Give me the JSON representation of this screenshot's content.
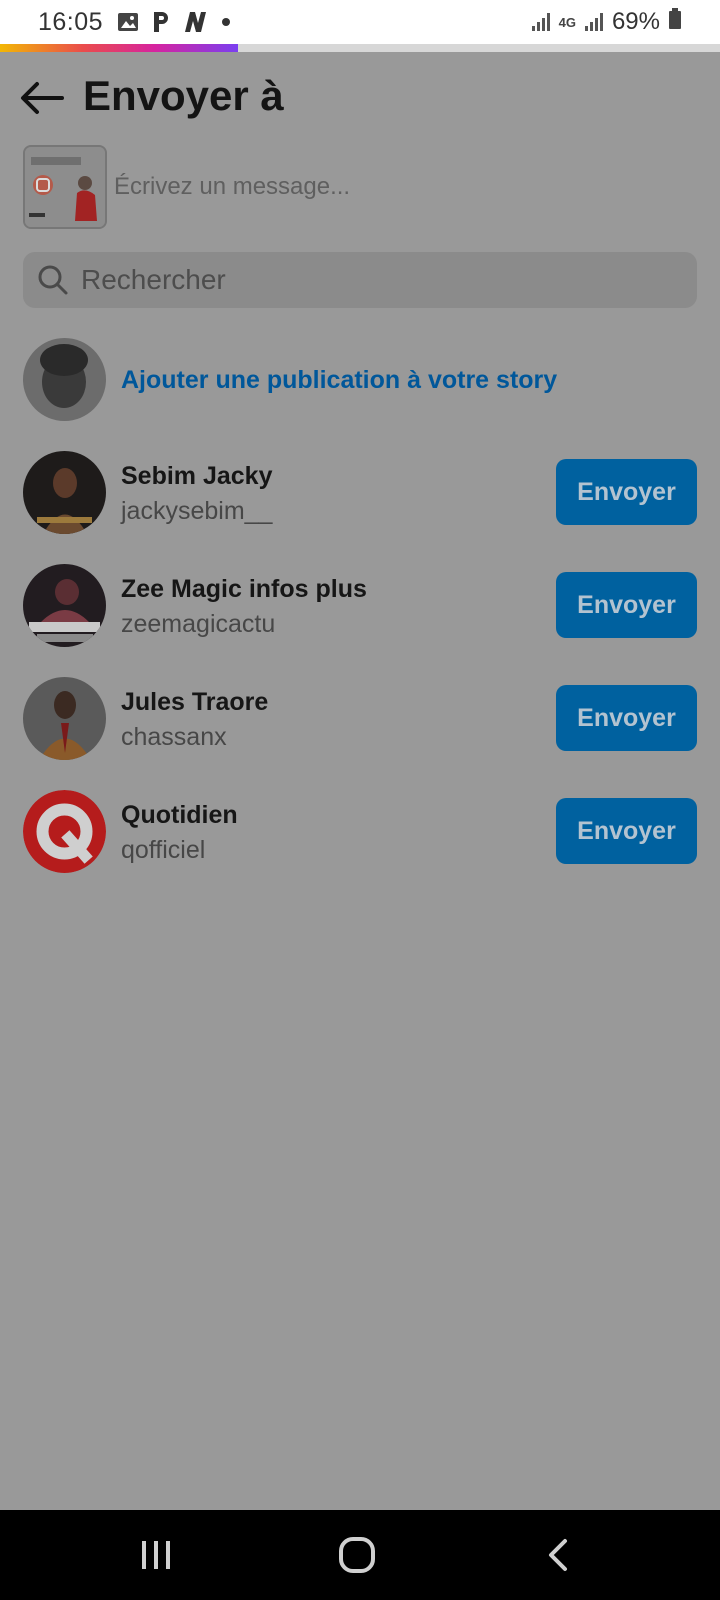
{
  "status_bar": {
    "time": "16:05",
    "left_icons": [
      "image-icon",
      "p-app-icon",
      "n-app-icon",
      "dot-icon"
    ],
    "network": "4G",
    "battery": "69%"
  },
  "progress": {
    "fraction": 0.33
  },
  "header": {
    "title": "Envoyer à",
    "back_icon": "arrow-left-icon"
  },
  "compose": {
    "placeholder": "Écrivez un message..."
  },
  "search": {
    "placeholder": "Rechercher",
    "icon": "search-icon"
  },
  "story_row": {
    "label": "Ajouter une publication à votre story"
  },
  "recipients": [
    {
      "name": "Sebim Jacky",
      "username": "jackysebim__",
      "button": "Envoyer"
    },
    {
      "name": "Zee Magic infos plus",
      "username": "zeemagicactu",
      "button": "Envoyer"
    },
    {
      "name": "Jules Traore",
      "username": "chassanx",
      "button": "Envoyer"
    },
    {
      "name": "Quotidien",
      "username": "qofficiel",
      "button": "Envoyer"
    }
  ],
  "colors": {
    "overlay_bg": "#999999",
    "accent_blue": "#00619f",
    "link_blue": "#00579a",
    "quotidien_red": "#b51c1c"
  },
  "nav_bar": {
    "icons": [
      "recent-apps-icon",
      "home-icon",
      "back-nav-icon"
    ]
  }
}
